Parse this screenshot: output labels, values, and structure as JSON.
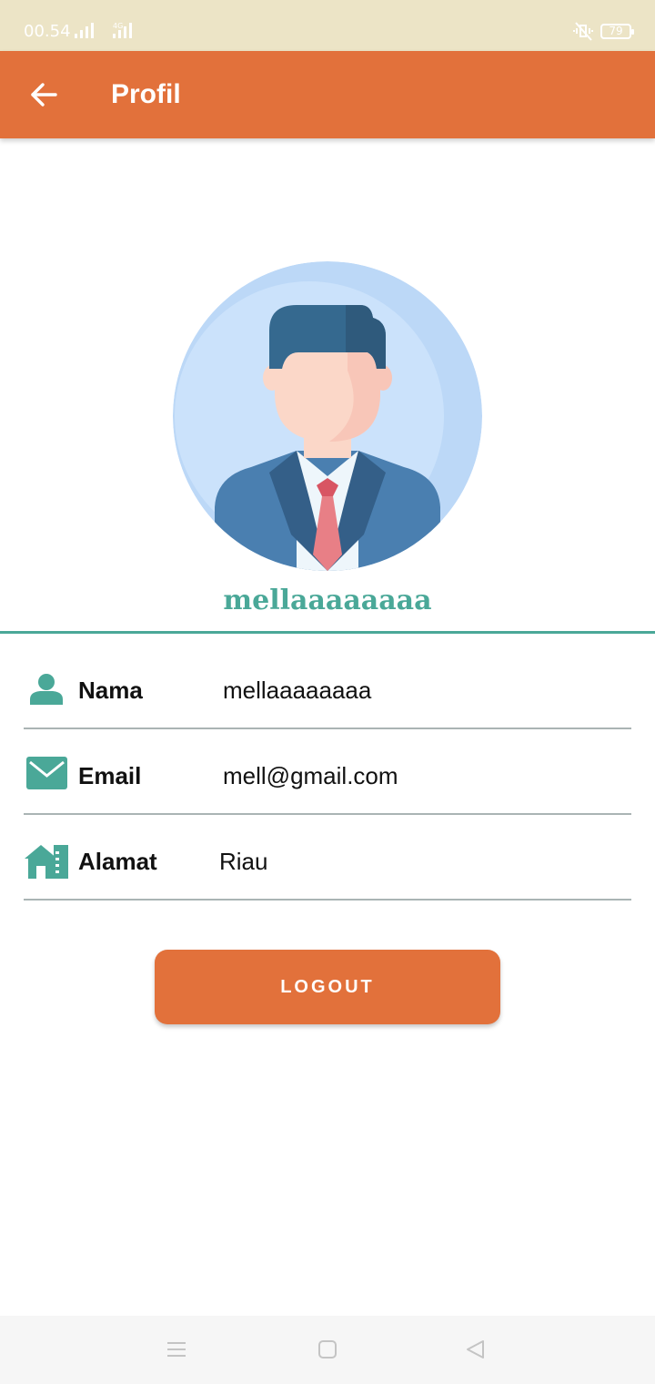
{
  "status_bar": {
    "time": "00.54",
    "network_label": "4G",
    "battery": "79",
    "icons": [
      "signal-icon",
      "signal-4g-icon",
      "mute-vibrate-icon",
      "battery-icon"
    ]
  },
  "app_bar": {
    "title": "Profil",
    "back_icon": "arrow-left-icon"
  },
  "profile": {
    "avatar": "businessman-avatar",
    "name": "mellaaaaaaaa"
  },
  "fields": [
    {
      "icon": "person-icon",
      "label": "Nama",
      "value": "mellaaaaaaaa"
    },
    {
      "icon": "mail-icon",
      "label": "Email",
      "value": "mell@gmail.com"
    },
    {
      "icon": "house-icon",
      "label": "Alamat",
      "value": "Riau"
    }
  ],
  "actions": {
    "logout_label": "LOGOUT"
  },
  "nav_bar": {
    "icons": [
      "menu-icon",
      "home-square-icon",
      "back-triangle-icon"
    ]
  },
  "colors": {
    "status_bar_bg": "#ece4c6",
    "primary": "#e2713b",
    "accent": "#4aa898",
    "divider": "#aab4b4"
  }
}
